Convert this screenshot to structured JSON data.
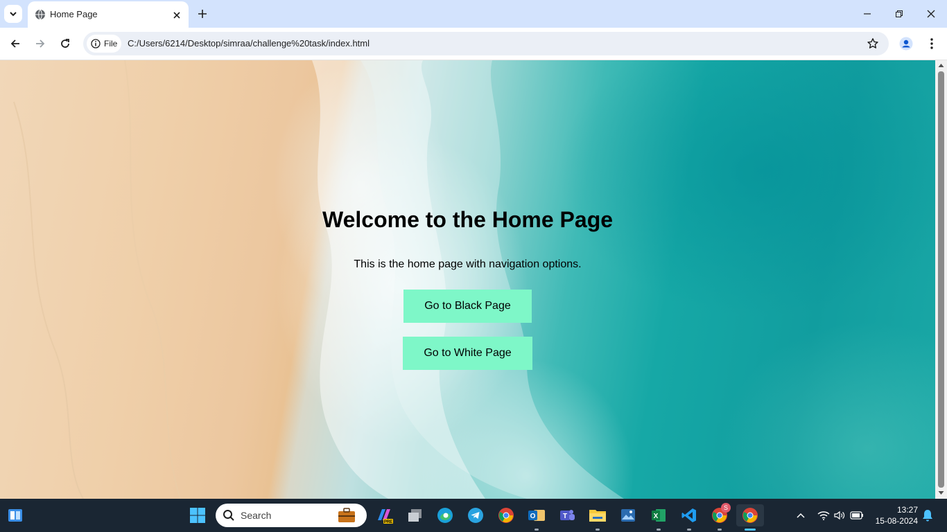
{
  "browser": {
    "tab_title": "Home Page",
    "url_scheme_label": "File",
    "url": "C:/Users/6214/Desktop/simraa/challenge%20task/index.html"
  },
  "page": {
    "heading": "Welcome to the Home Page",
    "subtitle": "This is the home page with navigation options.",
    "buttons": {
      "black": "Go to Black Page",
      "white": "Go to White Page"
    },
    "button_color": "#7ef7c8"
  },
  "taskbar": {
    "search_label": "Search",
    "time": "13:27",
    "date": "15-08-2024",
    "app_icons": [
      "start-icon",
      "taskview-icon",
      "copilot-pre-icon",
      "file-manager-icon",
      "edge-icon",
      "telegram-icon",
      "chrome-icon",
      "outlook-icon",
      "teams-icon",
      "file-explorer-icon",
      "photos-icon",
      "excel-icon",
      "vscode-icon",
      "chrome-profile-icon",
      "chrome-active-icon"
    ],
    "profile_badge": "S"
  },
  "colors": {
    "tabstrip": "#d3e3fd",
    "taskbar": "#1a2633"
  }
}
